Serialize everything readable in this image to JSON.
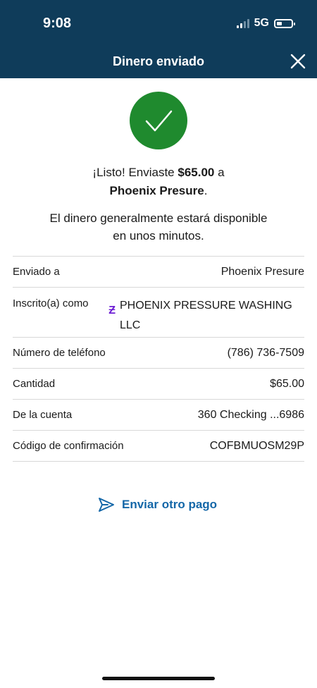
{
  "status_bar": {
    "time": "9:08",
    "network": "5G"
  },
  "header": {
    "title": "Dinero enviado"
  },
  "confirmation": {
    "prefix": "¡Listo! Enviaste ",
    "amount": "$65.00",
    "suffix": " a",
    "recipient": "Phoenix Presure",
    "period": ".",
    "availability_line1": "El dinero generalmente estará disponible",
    "availability_line2": "en unos minutos."
  },
  "details": {
    "sent_to_label": "Enviado a",
    "sent_to_value": "Phoenix Presure",
    "enrolled_label": "Inscrito(a) como",
    "enrolled_value": "PHOENIX PRESSURE WASHING LLC",
    "phone_label": "Número de teléfono",
    "phone_value": "(786) 736-7509",
    "amount_label": "Cantidad",
    "amount_value": "$65.00",
    "account_label": "De la cuenta",
    "account_value": "360 Checking ...6986",
    "code_label": "Código de confirmación",
    "code_value": "COFBMUOSM29P"
  },
  "actions": {
    "send_again_label": "Enviar otro pago"
  },
  "icons": {
    "success": "checkmark-icon",
    "close": "close-icon",
    "zelle": "zelle-icon",
    "send": "send-icon"
  },
  "colors": {
    "header_bg": "#0f3c5a",
    "success_green": "#1f8a2e",
    "link_blue": "#1467a8",
    "zelle_purple": "#6d1ed4"
  }
}
